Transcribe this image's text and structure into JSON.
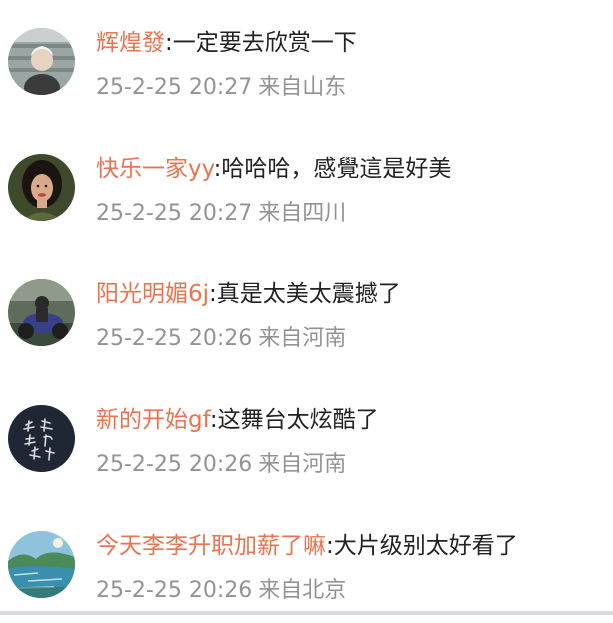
{
  "colors": {
    "username": "#eb7350",
    "text": "#222222",
    "meta": "#939393"
  },
  "comments": [
    {
      "avatar_icon": "elderly-person-photo-avatar",
      "username": "辉煌發",
      "separator": ":",
      "text": "一定要去欣赏一下",
      "time": "25-2-25 20:27",
      "location": "来自山东"
    },
    {
      "avatar_icon": "woman-portrait-photo-avatar",
      "username": "快乐一家yy",
      "separator": ":",
      "text": "哈哈哈，感覺這是好美",
      "time": "25-2-25 20:27",
      "location": "来自四川"
    },
    {
      "avatar_icon": "motorcycle-rider-photo-avatar",
      "username": "阳光明媚6j",
      "separator": ":",
      "text": "真是太美太震撼了",
      "time": "25-2-25 20:26",
      "location": "来自河南"
    },
    {
      "avatar_icon": "calligraphy-dark-avatar",
      "username": "新的开始gf",
      "separator": ":",
      "text": "这舞台太炫酷了",
      "time": "25-2-25 20:26",
      "location": "来自河南"
    },
    {
      "avatar_icon": "landscape-lake-photo-avatar",
      "username": "今天李李升职加薪了嘛",
      "separator": ":",
      "text": "大片级别太好看了",
      "time": "25-2-25 20:26",
      "location": "来自北京"
    }
  ]
}
